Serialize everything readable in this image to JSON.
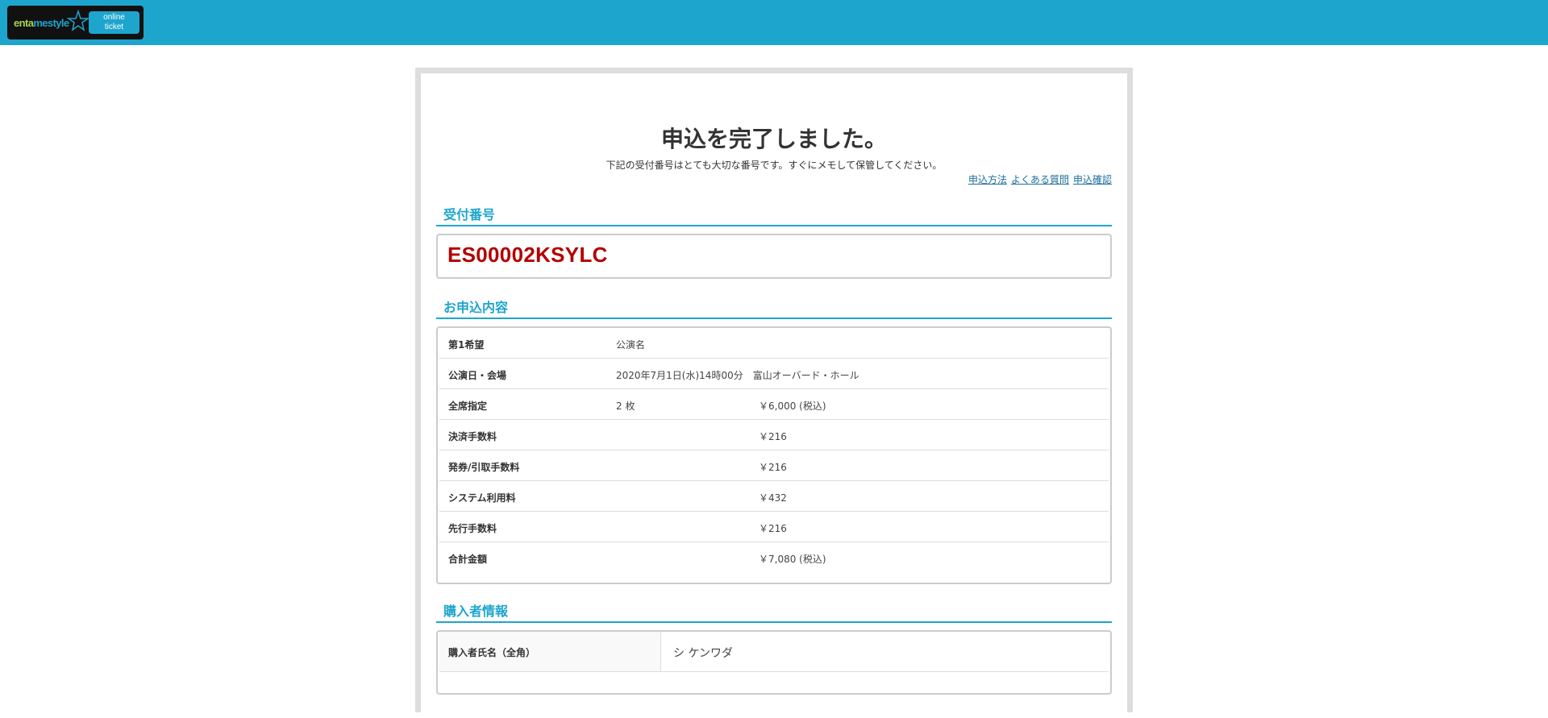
{
  "header": {
    "logo_part1": "enta",
    "logo_part2": "mestyle",
    "logo_button": [
      "online",
      "ticket"
    ],
    "colors": {
      "bar": "#1ea5cd",
      "logo_bg": "#111111",
      "logo_green": "#a5d34a"
    }
  },
  "page": {
    "title": "申込を完了しました。",
    "subtitle": "下記の受付番号はとても大切な番号です。すぐにメモして保管してください。",
    "links": [
      "申込方法",
      "よくある質問",
      "申込確認"
    ]
  },
  "reception": {
    "heading": "受付番号",
    "number": "ES00002KSYLC",
    "number_color": "#b30000"
  },
  "details": {
    "heading": "お申込内容",
    "rows": [
      {
        "label": "第1希望",
        "value": "公演名",
        "amount": ""
      },
      {
        "label": "公演日・会場",
        "value": "2020年7月1日(水)14時00分　富山オーバード・ホール",
        "amount": ""
      },
      {
        "label": "全席指定",
        "value": "2 枚",
        "amount": "￥6,000 (税込)"
      },
      {
        "label": "決済手数料",
        "value": "",
        "amount": "￥216"
      },
      {
        "label": "発券/引取手数料",
        "value": "",
        "amount": "￥216"
      },
      {
        "label": "システム利用料",
        "value": "",
        "amount": "￥432"
      },
      {
        "label": "先行手数料",
        "value": "",
        "amount": "￥216"
      },
      {
        "label": "合計金額",
        "value": "",
        "amount": "￥7,080 (税込)"
      }
    ]
  },
  "buyer": {
    "heading": "購入者情報",
    "rows": [
      {
        "label": "購入者氏名（全角）",
        "value": "シ ケンワダ"
      }
    ]
  }
}
